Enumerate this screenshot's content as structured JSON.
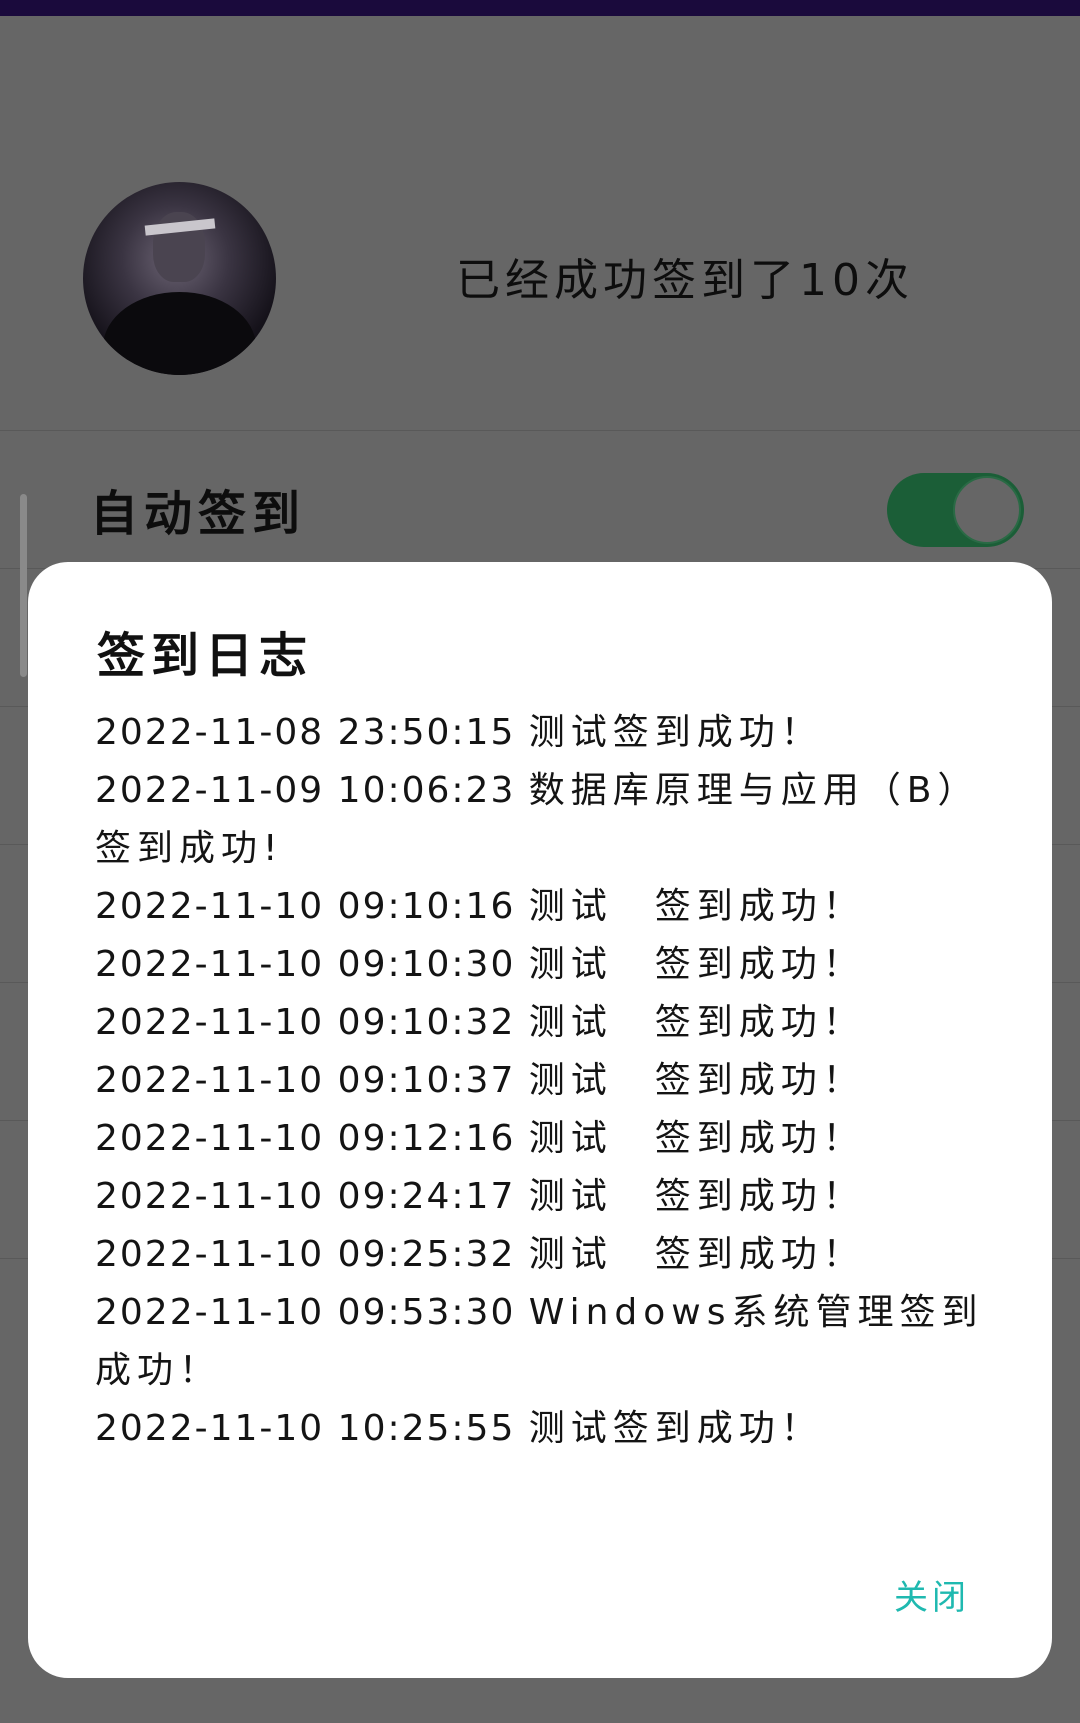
{
  "profile": {
    "signed_count_text": "已经成功签到了10次"
  },
  "settings": {
    "auto_signin_label": "自动签到",
    "auto_signin_enabled": true
  },
  "dialog": {
    "title": "签到日志",
    "entries": [
      {
        "time": "2022-11-08 23:50:15",
        "message": "测试签到成功！"
      },
      {
        "time": "2022-11-09 10:06:23",
        "message": "数据库原理与应用（B）签到成功!"
      },
      {
        "time": "2022-11-10 09:10:16",
        "message": "测试　签到成功！"
      },
      {
        "time": "2022-11-10 09:10:30",
        "message": "测试　签到成功！"
      },
      {
        "time": "2022-11-10 09:10:32",
        "message": "测试　签到成功！"
      },
      {
        "time": "2022-11-10 09:10:37",
        "message": "测试　签到成功！"
      },
      {
        "time": "2022-11-10 09:12:16",
        "message": "测试　签到成功！"
      },
      {
        "time": "2022-11-10 09:24:17",
        "message": "测试　签到成功！"
      },
      {
        "time": "2022-11-10 09:25:32",
        "message": "测试　签到成功！"
      },
      {
        "time": "2022-11-10 09:53:30",
        "message": "Windows系统管理签到成功！"
      },
      {
        "time": "2022-11-10 10:25:55",
        "message": "测试签到成功！"
      }
    ],
    "close_label": "关闭"
  },
  "colors": {
    "accent": "#1fb9b0",
    "toggle_on": "#1b5e37",
    "scrim": "#666666"
  }
}
